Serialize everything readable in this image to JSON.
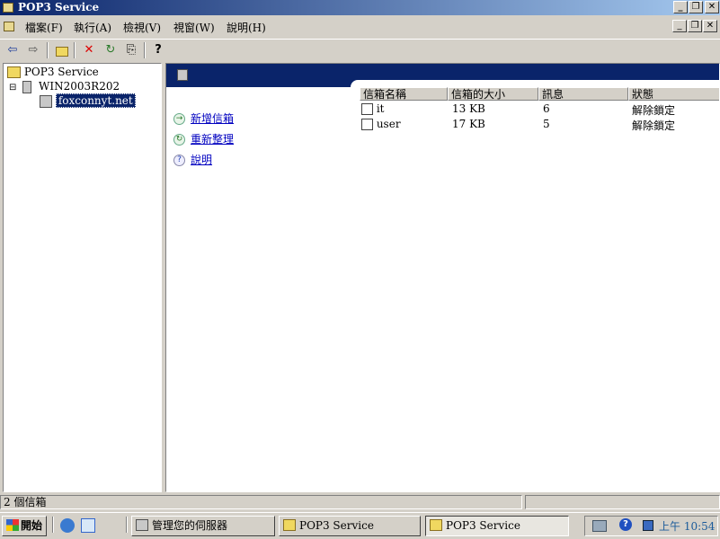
{
  "window": {
    "title": "POP3 Service",
    "minimize_label": "_",
    "restore_label": "❐",
    "close_label": "✕"
  },
  "menu": {
    "items": [
      {
        "label": "檔案(F)"
      },
      {
        "label": "執行(A)"
      },
      {
        "label": "檢視(V)"
      },
      {
        "label": "視窗(W)"
      },
      {
        "label": "說明(H)"
      }
    ]
  },
  "toolbar": {
    "icons": [
      "back-icon",
      "forward-icon",
      "up-folder-icon",
      "delete-icon",
      "refresh-icon",
      "export-icon",
      "help-icon"
    ],
    "back_glyph": "⇦",
    "forward_glyph": "⇨",
    "delete_glyph": "✕",
    "refresh_glyph": "↻",
    "export_glyph": "⎘",
    "help_glyph": "?"
  },
  "tree": {
    "root": "POP3 Service",
    "server": "WIN2003R202",
    "domain": "foxconnyt.net",
    "expand_glyph": "⊟"
  },
  "tasks": [
    {
      "label": "新增信箱",
      "glyph": "→"
    },
    {
      "label": "重新整理",
      "glyph": "↻"
    },
    {
      "label": "說明",
      "glyph": "?"
    }
  ],
  "mailbox_list": {
    "columns": [
      "信箱名稱",
      "信箱的大小",
      "訊息",
      "狀態"
    ],
    "rows": [
      {
        "name": "it",
        "size": "13 KB",
        "messages": "6",
        "status": "解除鎖定"
      },
      {
        "name": "user",
        "size": "17 KB",
        "messages": "5",
        "status": "解除鎖定"
      }
    ]
  },
  "status": {
    "text": "2 個信箱"
  },
  "taskbar": {
    "start_label": "開始",
    "buttons": [
      {
        "label": "管理您的伺服器"
      },
      {
        "label": "POP3 Service"
      },
      {
        "label": "POP3 Service"
      }
    ],
    "clock": "上午 10:54",
    "help_glyph": "?"
  },
  "colors": {
    "title_start": "#0a246a",
    "title_end": "#a6caf0",
    "link": "#0000c0",
    "face": "#d4d0c8"
  }
}
